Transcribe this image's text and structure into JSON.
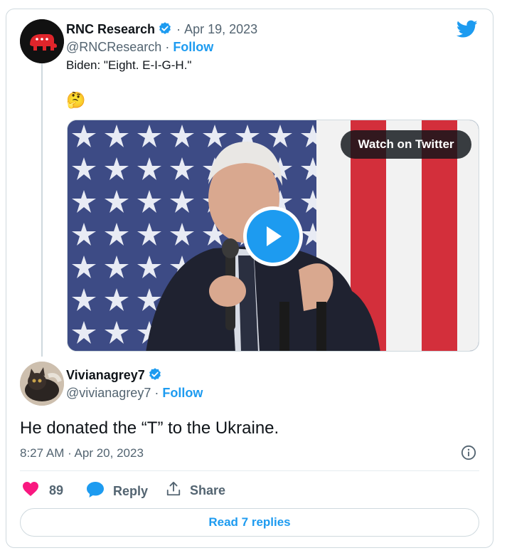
{
  "tweet1": {
    "name": "RNC Research",
    "separator": "·",
    "date": "Apr 19, 2023",
    "handle": "@RNCResearch",
    "follow": "Follow",
    "text": "Biden: \"Eight. E-I-G-H.\"",
    "emoji": "🤔",
    "media_button": "Watch on Twitter"
  },
  "tweet2": {
    "name": "Vivianagrey7",
    "handle": "@vivianagrey7",
    "follow": "Follow",
    "text": "He donated the “T” to the Ukraine.",
    "timestamp": "8:27 AM · Apr 20, 2023"
  },
  "actions": {
    "likes": "89",
    "reply": "Reply",
    "share": "Share"
  },
  "read_replies": "Read 7 replies",
  "colors": {
    "accent": "#1d9bf0",
    "like": "#f91880",
    "muted": "#536471",
    "text": "#0f1419"
  },
  "icons": [
    "twitter-bird-icon",
    "verified-badge-icon",
    "play-icon",
    "info-icon",
    "heart-icon",
    "reply-bubble-icon",
    "share-upload-icon"
  ]
}
